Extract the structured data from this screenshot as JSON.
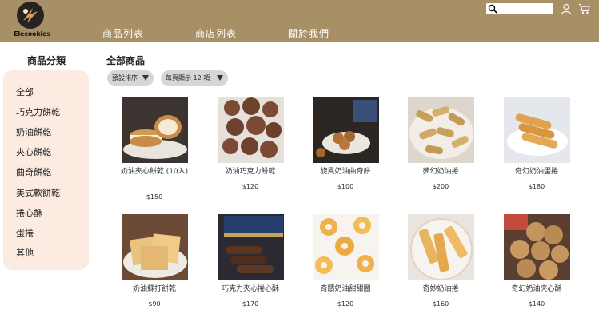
{
  "header": {
    "logo_text": "Elecookies",
    "nav": [
      "商品列表",
      "商店列表",
      "關於我們"
    ],
    "search": {
      "placeholder": "",
      "value": ""
    },
    "colors": {
      "bar": "#a89066",
      "nav_text": "#ffffff"
    },
    "icons": [
      "search-icon",
      "user-icon",
      "cart-icon"
    ]
  },
  "sidebar": {
    "title": "商品分類",
    "items": [
      "全部",
      "巧克力餅乾",
      "奶油餅乾",
      "夾心餅乾",
      "曲奇餅乾",
      "美式軟餅乾",
      "捲心酥",
      "蛋捲",
      "其他"
    ],
    "bg_color": "#fbebe0"
  },
  "main": {
    "title": "全部商品",
    "sort_select": "預設排序",
    "per_page_select": "每頁顯示 12 項",
    "products": [
      {
        "name": "奶油夾心餅乾 (10入)",
        "price": "$150"
      },
      {
        "name": "奶油巧克力餅乾",
        "price": "$120"
      },
      {
        "name": "旋風奶油曲奇餅",
        "price": "$100"
      },
      {
        "name": "夢幻奶油捲",
        "price": "$200"
      },
      {
        "name": "奇幻奶油蛋捲",
        "price": "$180"
      },
      {
        "name": "奶油蘇打餅乾",
        "price": "$90"
      },
      {
        "name": "巧克力夾心捲心酥",
        "price": "$170"
      },
      {
        "name": "奇蹟奶油甜甜圈",
        "price": "$120"
      },
      {
        "name": "奇妙奶油捲",
        "price": "$160"
      },
      {
        "name": "奇幻奶油夾心酥",
        "price": "$140"
      }
    ]
  }
}
